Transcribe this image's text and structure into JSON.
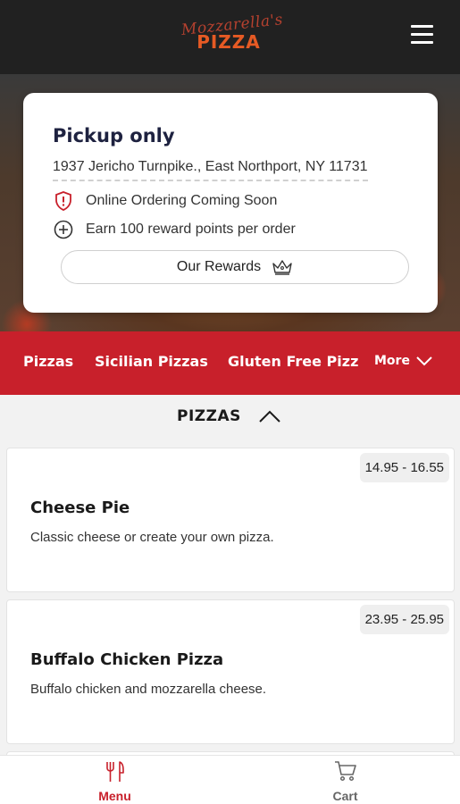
{
  "header": {
    "logo_script": "Mozzarella's",
    "logo_main": "PIZZA"
  },
  "store_card": {
    "title": "Pickup only",
    "address": "1937 Jericho Turnpike., East Northport, NY 11731",
    "notices": [
      {
        "icon": "alert-shield-icon",
        "text": "Online Ordering Coming Soon"
      },
      {
        "icon": "plus-circle-icon",
        "text": "Earn 100 reward points per order"
      }
    ],
    "rewards_button": "Our Rewards"
  },
  "categories": {
    "items": [
      "Pizzas",
      "Sicilian Pizzas",
      "Gluten Free Pizzas"
    ],
    "more_label": "More"
  },
  "section": {
    "title": "PIZZAS"
  },
  "menu_items": [
    {
      "name": "Cheese Pie",
      "description": "Classic cheese or create your own pizza.",
      "price": "14.95 - 16.55"
    },
    {
      "name": "Buffalo Chicken Pizza",
      "description": "Buffalo chicken and mozzarella cheese.",
      "price": "23.95 - 25.95"
    }
  ],
  "bottom_nav": {
    "tabs": [
      {
        "label": "Menu",
        "icon": "utensils-icon",
        "active": true
      },
      {
        "label": "Cart",
        "icon": "cart-icon",
        "active": false
      }
    ]
  },
  "colors": {
    "brand_red": "#c8202b",
    "header_dark": "#212121",
    "logo_orange": "#e65a24",
    "title_navy": "#1e2240"
  }
}
